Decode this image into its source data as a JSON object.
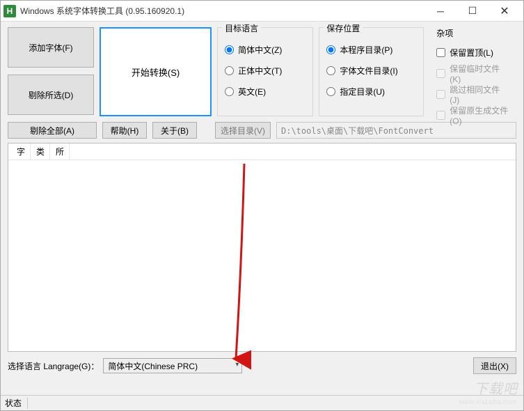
{
  "titlebar": {
    "title": "Windows 系统字体转换工具 (0.95.160920.1)"
  },
  "buttons": {
    "add_font": "添加字体(F)",
    "remove_selected": "剔除所选(D)",
    "remove_all": "剔除全部(A)",
    "start": "开始转换(S)",
    "help": "帮助(H)",
    "about": "关于(B)",
    "select_dir": "选择目录(V)",
    "exit": "退出(X)"
  },
  "groups": {
    "target_lang": {
      "title": "目标语言",
      "options": [
        {
          "label": "简体中文(Z)",
          "checked": true
        },
        {
          "label": "正体中文(T)",
          "checked": false
        },
        {
          "label": "英文(E)",
          "checked": false
        }
      ]
    },
    "save_loc": {
      "title": "保存位置",
      "options": [
        {
          "label": "本程序目录(P)",
          "checked": true
        },
        {
          "label": "字体文件目录(I)",
          "checked": false
        },
        {
          "label": "指定目录(U)",
          "checked": false
        }
      ]
    },
    "misc": {
      "title": "杂项",
      "options": [
        {
          "label": "保留置顶(L)",
          "checked": false,
          "disabled": false
        },
        {
          "label": "保留临时文件(K)",
          "checked": false,
          "disabled": true
        },
        {
          "label": "跳过相同文件(J)",
          "checked": false,
          "disabled": true
        },
        {
          "label": "保留原生成文件(O)",
          "checked": false,
          "disabled": true
        }
      ]
    }
  },
  "path": "D:\\tools\\桌面\\下载吧\\FontConvert",
  "columns": [
    "字",
    "类",
    "所"
  ],
  "language_row": {
    "label": "选择语言 Langrage(G)：",
    "selected": "简体中文(Chinese PRC)"
  },
  "status": {
    "label": "状态"
  },
  "watermark": "下载吧",
  "watermark_sub": "www.xiazaiba.com",
  "annotation_arrow_color": "#d11515"
}
